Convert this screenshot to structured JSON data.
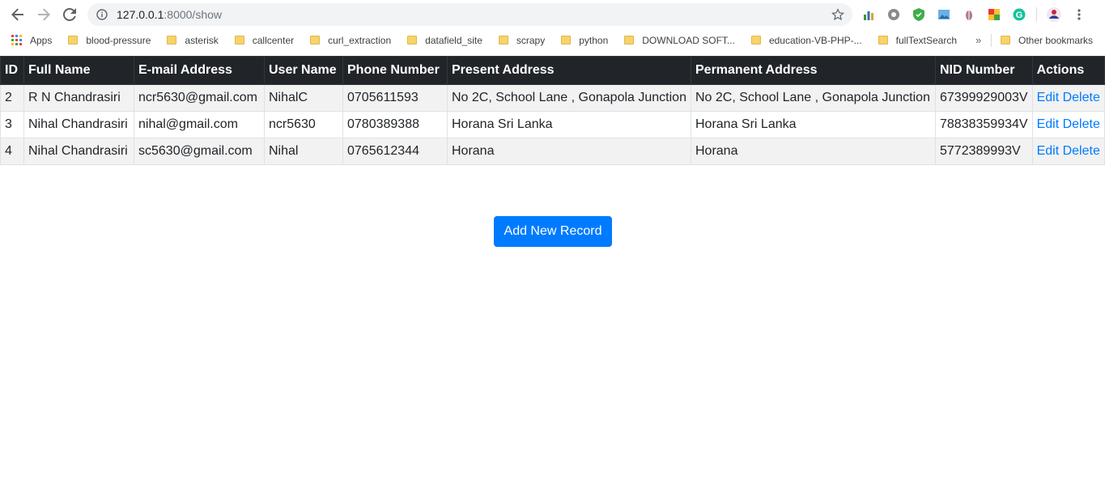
{
  "browser": {
    "url_host": "127.0.0.1",
    "url_path": ":8000/show",
    "bookmarks": [
      {
        "label": "Apps",
        "icon": "apps-grid-icon"
      },
      {
        "label": "blood-pressure",
        "icon": "folder-icon"
      },
      {
        "label": "asterisk",
        "icon": "folder-icon"
      },
      {
        "label": "callcenter",
        "icon": "folder-icon"
      },
      {
        "label": "curl_extraction",
        "icon": "folder-icon"
      },
      {
        "label": "datafield_site",
        "icon": "folder-icon"
      },
      {
        "label": "scrapy",
        "icon": "folder-icon"
      },
      {
        "label": "python",
        "icon": "folder-icon"
      },
      {
        "label": "DOWNLOAD SOFT...",
        "icon": "folder-icon"
      },
      {
        "label": "education-VB-PHP-...",
        "icon": "folder-icon"
      },
      {
        "label": "fullTextSearch",
        "icon": "folder-icon"
      }
    ],
    "more_label": "»",
    "other_bookmarks": "Other bookmarks"
  },
  "table": {
    "headers": [
      "ID",
      "Full Name",
      "E-mail Address",
      "User Name",
      "Phone Number",
      "Present Address",
      "Permanent Address",
      "NID Number",
      "Actions"
    ],
    "rows": [
      {
        "id": "2",
        "full_name": "R N Chandrasiri",
        "email": "ncr5630@gmail.com",
        "user_name": "NihalC",
        "phone": "0705611593",
        "present_address": "No 2C, School Lane , Gonapola Junction",
        "permanent_address": "No 2C, School Lane , Gonapola Junction",
        "nid": "67399929003V",
        "edit": "Edit",
        "delete": "Delete"
      },
      {
        "id": "3",
        "full_name": "Nihal Chandrasiri",
        "email": "nihal@gmail.com",
        "user_name": "ncr5630",
        "phone": "0780389388",
        "present_address": "Horana Sri Lanka",
        "permanent_address": "Horana Sri Lanka",
        "nid": "78838359934V",
        "edit": "Edit",
        "delete": "Delete"
      },
      {
        "id": "4",
        "full_name": "Nihal Chandrasiri",
        "email": "sc5630@gmail.com",
        "user_name": "Nihal",
        "phone": "0765612344",
        "present_address": "Horana",
        "permanent_address": "Horana",
        "nid": "5772389993V",
        "edit": "Edit",
        "delete": "Delete"
      }
    ]
  },
  "add_button": "Add New Record",
  "colors": {
    "primary": "#007bff",
    "table_header": "#212529"
  }
}
